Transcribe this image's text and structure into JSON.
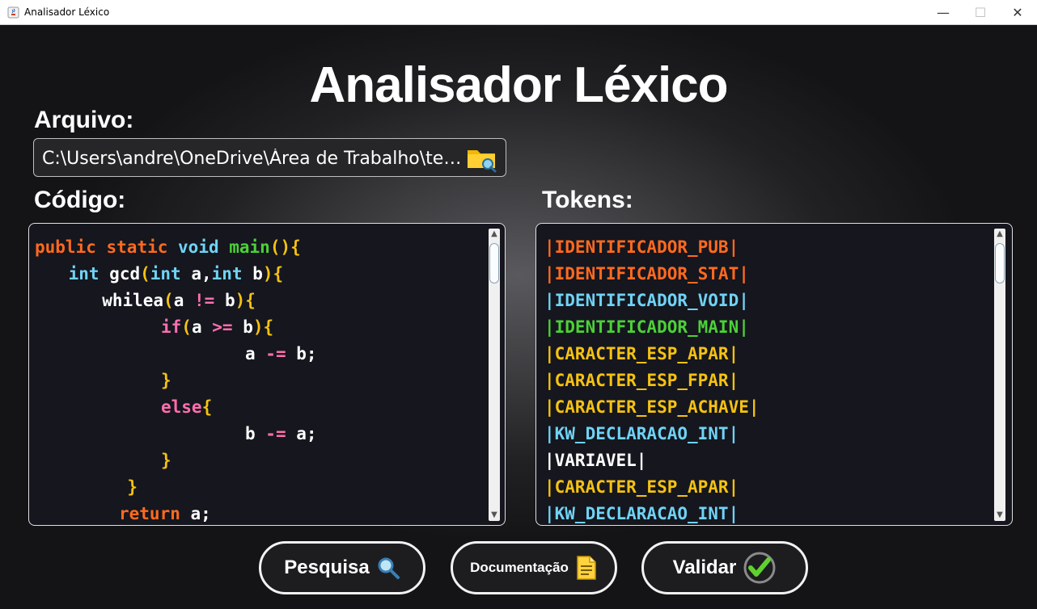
{
  "window": {
    "title": "Analisador Léxico",
    "minimize_glyph": "—",
    "maximize_glyph": "☐",
    "close_glyph": "✕"
  },
  "header": {
    "title": "Analisador Léxico"
  },
  "file": {
    "label": "Arquivo:",
    "path": "C:\\Users\\andre\\OneDrive\\Área de Trabalho\\test...",
    "icon": "folder-search-icon"
  },
  "code": {
    "label": "Código:",
    "lines": [
      {
        "indent": 0,
        "parts": [
          {
            "t": "public ",
            "c": "#ff6a1f"
          },
          {
            "t": "static ",
            "c": "#ff6a1f"
          },
          {
            "t": "void ",
            "c": "#6fd3f5"
          },
          {
            "t": "main",
            "c": "#4cd137"
          },
          {
            "t": "(){",
            "c": "#f5c211"
          }
        ]
      },
      {
        "indent": 4,
        "parts": [
          {
            "t": "int ",
            "c": "#6fd3f5"
          },
          {
            "t": "gcd",
            "c": "#ffffff"
          },
          {
            "t": "(",
            "c": "#f5c211"
          },
          {
            "t": "int ",
            "c": "#6fd3f5"
          },
          {
            "t": "a,",
            "c": "#ffffff"
          },
          {
            "t": "int ",
            "c": "#6fd3f5"
          },
          {
            "t": "b",
            "c": "#ffffff"
          },
          {
            "t": "){",
            "c": "#f5c211"
          }
        ]
      },
      {
        "indent": 8,
        "parts": [
          {
            "t": "whilea",
            "c": "#ffffff"
          },
          {
            "t": "(",
            "c": "#f5c211"
          },
          {
            "t": "a ",
            "c": "#ffffff"
          },
          {
            "t": "!= ",
            "c": "#ff6fae"
          },
          {
            "t": "b",
            "c": "#ffffff"
          },
          {
            "t": "){",
            "c": "#f5c211"
          }
        ]
      },
      {
        "indent": 15,
        "parts": [
          {
            "t": "if",
            "c": "#ff6fae"
          },
          {
            "t": "(",
            "c": "#f5c211"
          },
          {
            "t": "a ",
            "c": "#ffffff"
          },
          {
            "t": ">= ",
            "c": "#ff6fae"
          },
          {
            "t": "b",
            "c": "#ffffff"
          },
          {
            "t": "){",
            "c": "#f5c211"
          }
        ]
      },
      {
        "indent": 25,
        "parts": [
          {
            "t": "a ",
            "c": "#ffffff"
          },
          {
            "t": "-= ",
            "c": "#ff6fae"
          },
          {
            "t": "b;",
            "c": "#ffffff"
          }
        ]
      },
      {
        "indent": 15,
        "parts": [
          {
            "t": "}",
            "c": "#f5c211"
          }
        ]
      },
      {
        "indent": 15,
        "parts": [
          {
            "t": "else",
            "c": "#ff6fae"
          },
          {
            "t": "{",
            "c": "#f5c211"
          }
        ]
      },
      {
        "indent": 25,
        "parts": [
          {
            "t": "b ",
            "c": "#ffffff"
          },
          {
            "t": "-= ",
            "c": "#ff6fae"
          },
          {
            "t": "a;",
            "c": "#ffffff"
          }
        ]
      },
      {
        "indent": 15,
        "parts": [
          {
            "t": "}",
            "c": "#f5c211"
          }
        ]
      },
      {
        "indent": 11,
        "parts": [
          {
            "t": "}",
            "c": "#f5c211"
          }
        ]
      },
      {
        "indent": 10,
        "parts": [
          {
            "t": "return ",
            "c": "#ff6a1f"
          },
          {
            "t": "a;",
            "c": "#ffffff"
          }
        ]
      }
    ]
  },
  "tokens": {
    "label": "Tokens:",
    "items": [
      {
        "text": "|IDENTIFICADOR_PUB|",
        "c": "#ff6a1f"
      },
      {
        "text": "|IDENTIFICADOR_STAT|",
        "c": "#ff6a1f"
      },
      {
        "text": "|IDENTIFICADOR_VOID|",
        "c": "#6fd3f5"
      },
      {
        "text": "|IDENTIFICADOR_MAIN|",
        "c": "#4cd137"
      },
      {
        "text": "|CARACTER_ESP_APAR|",
        "c": "#f5c211"
      },
      {
        "text": "|CARACTER_ESP_FPAR|",
        "c": "#f5c211"
      },
      {
        "text": "|CARACTER_ESP_ACHAVE|",
        "c": "#f5c211"
      },
      {
        "text": "|KW_DECLARACAO_INT|",
        "c": "#6fd3f5"
      },
      {
        "text": "|VARIAVEL|",
        "c": "#ffffff"
      },
      {
        "text": "|CARACTER_ESP_APAR|",
        "c": "#f5c211"
      },
      {
        "text": "|KW_DECLARACAO_INT|",
        "c": "#6fd3f5"
      }
    ]
  },
  "scrollbar": {
    "up": "▲",
    "down": "▼"
  },
  "buttons": {
    "search": {
      "label": "Pesquisa",
      "icon": "magnifier-icon"
    },
    "docs": {
      "label": "Documentação",
      "icon": "document-icon"
    },
    "validate": {
      "label": "Validar",
      "icon": "check-circle-icon"
    }
  },
  "colors": {
    "orange": "#ff6a1f",
    "cyan": "#6fd3f5",
    "green": "#4cd137",
    "yellow": "#f5c211",
    "pink": "#ff6fae"
  }
}
